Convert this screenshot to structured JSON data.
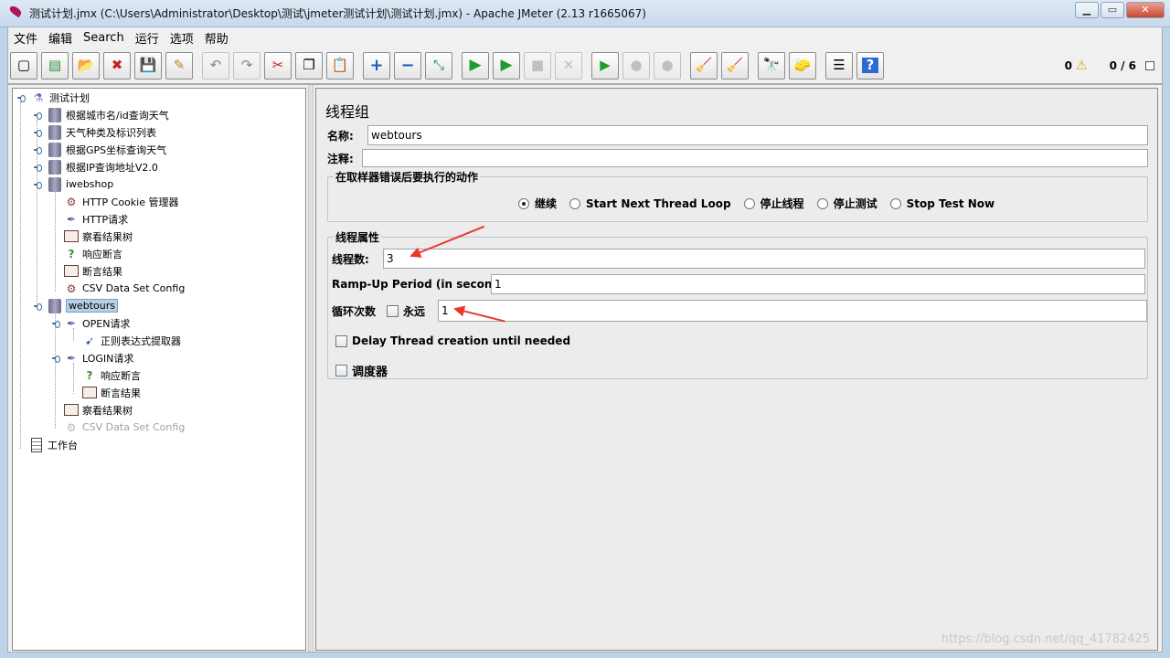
{
  "window": {
    "title": "测试计划.jmx (C:\\Users\\Administrator\\Desktop\\测试\\jmeter测试计划\\测试计划.jmx) - Apache JMeter (2.13 r1665067)"
  },
  "menu": [
    "文件",
    "编辑",
    "Search",
    "运行",
    "选项",
    "帮助"
  ],
  "toolbar": {
    "buttons": [
      {
        "name": "new-icon",
        "glyph": "▢"
      },
      {
        "name": "templates-icon",
        "glyph": "▤"
      },
      {
        "name": "open-icon",
        "glyph": "📂"
      },
      {
        "name": "close-file-icon",
        "glyph": "✖"
      },
      {
        "name": "save-icon",
        "glyph": "💾"
      },
      {
        "name": "save-as-icon",
        "glyph": "✎"
      },
      {
        "name": "undo-icon",
        "glyph": "↶"
      },
      {
        "name": "redo-icon",
        "glyph": "↷"
      },
      {
        "name": "cut-icon",
        "glyph": "✂"
      },
      {
        "name": "copy-icon",
        "glyph": "❐"
      },
      {
        "name": "paste-icon",
        "glyph": "📋"
      },
      {
        "name": "expand-icon",
        "glyph": "+"
      },
      {
        "name": "collapse-icon",
        "glyph": "−"
      },
      {
        "name": "toggle-icon",
        "glyph": "⤡"
      },
      {
        "name": "start-icon",
        "glyph": "▶"
      },
      {
        "name": "start-no-pause-icon",
        "glyph": "▶"
      },
      {
        "name": "stop-icon",
        "glyph": "■"
      },
      {
        "name": "shutdown-icon",
        "glyph": "✕"
      },
      {
        "name": "remote-start-icon",
        "glyph": "▶"
      },
      {
        "name": "remote-stop-icon",
        "glyph": "●"
      },
      {
        "name": "remote-shutdown-icon",
        "glyph": "●"
      },
      {
        "name": "clear-icon",
        "glyph": "🧹"
      },
      {
        "name": "clear-all-icon",
        "glyph": "🧹"
      },
      {
        "name": "search-icon",
        "glyph": "🔭"
      },
      {
        "name": "reset-search-icon",
        "glyph": "🧽"
      },
      {
        "name": "function-helper-icon",
        "glyph": "☰"
      },
      {
        "name": "help-icon",
        "glyph": "?"
      }
    ],
    "error_count": "0",
    "threads": "0 / 6"
  },
  "tree": [
    {
      "label": "测试计划",
      "kind": "plan"
    },
    {
      "label": "根据城市名/id查询天气",
      "kind": "thread"
    },
    {
      "label": "天气种类及标识列表",
      "kind": "thread"
    },
    {
      "label": "根据GPS坐标查询天气",
      "kind": "thread"
    },
    {
      "label": "根据IP查询地址V2.0",
      "kind": "thread"
    },
    {
      "label": "iwebshop",
      "kind": "thread"
    },
    {
      "label": "HTTP Cookie 管理器",
      "kind": "config"
    },
    {
      "label": "HTTP请求",
      "kind": "sampler"
    },
    {
      "label": "察看结果树",
      "kind": "listener"
    },
    {
      "label": "响应断言",
      "kind": "assert"
    },
    {
      "label": "断言结果",
      "kind": "listener"
    },
    {
      "label": "CSV Data Set Config",
      "kind": "config"
    },
    {
      "label": "webtours",
      "kind": "thread"
    },
    {
      "label": "OPEN请求",
      "kind": "sampler"
    },
    {
      "label": "正则表达式提取器",
      "kind": "extract"
    },
    {
      "label": "LOGIN请求",
      "kind": "sampler"
    },
    {
      "label": "响应断言",
      "kind": "assert"
    },
    {
      "label": "断言结果",
      "kind": "listener"
    },
    {
      "label": "察看结果树",
      "kind": "listener"
    },
    {
      "label": "CSV Data Set Config",
      "kind": "config"
    },
    {
      "label": "工作台",
      "kind": "workbench"
    }
  ],
  "panel": {
    "title": "线程组",
    "name_label": "名称:",
    "name_value": "webtours",
    "comment_label": "注释:",
    "comment_value": "",
    "error_action": {
      "title": "在取样器错误后要执行的动作",
      "options": [
        "继续",
        "Start Next Thread Loop",
        "停止线程",
        "停止测试",
        "Stop Test Now"
      ],
      "selected": "继续"
    },
    "thread_props": {
      "title": "线程属性",
      "threads_label": "线程数:",
      "threads_value": "3",
      "rampup_label": "Ramp-Up Period (in seconds):",
      "rampup_value": "1",
      "loop_label": "循环次数",
      "forever_label": "永远",
      "loop_value": "1",
      "delay_label": "Delay Thread creation until needed",
      "scheduler_label": "调度器"
    }
  },
  "watermark": "https://blog.csdn.net/qq_41782425",
  "colors": {
    "accent_arrow": "#e8382b",
    "selection": "#b8cfe5"
  }
}
